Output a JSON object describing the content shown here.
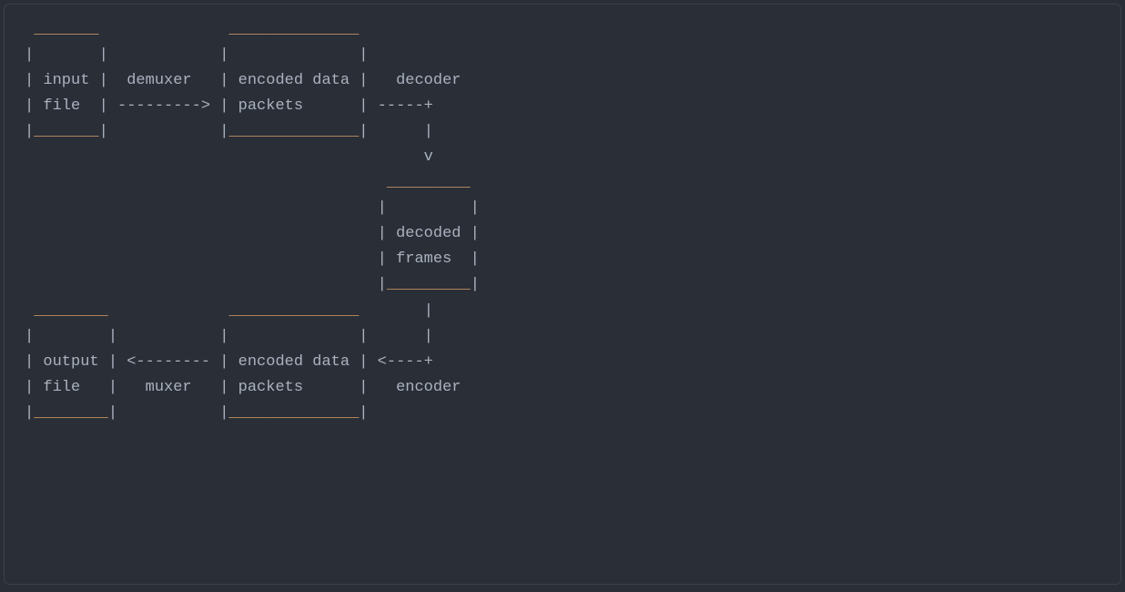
{
  "diagram": {
    "lines": [
      {
        "segments": [
          {
            "t": " "
          },
          {
            "t": "_______",
            "c": "accent"
          },
          {
            "t": "              "
          },
          {
            "t": "______________",
            "c": "accent"
          }
        ]
      },
      {
        "segments": [
          {
            "t": "|       |            |              |"
          }
        ]
      },
      {
        "segments": [
          {
            "t": "| input |  demuxer   | encoded data |   decoder"
          }
        ]
      },
      {
        "segments": [
          {
            "t": "| file  | ---------> | packets      | -----+"
          }
        ]
      },
      {
        "segments": [
          {
            "t": "|"
          },
          {
            "t": "_______",
            "c": "accent"
          },
          {
            "t": "|            |"
          },
          {
            "t": "______________",
            "c": "accent"
          },
          {
            "t": "|      |"
          }
        ]
      },
      {
        "segments": [
          {
            "t": "                                           v"
          }
        ]
      },
      {
        "segments": [
          {
            "t": "                                       "
          },
          {
            "t": "_________",
            "c": "accent"
          }
        ]
      },
      {
        "segments": [
          {
            "t": "                                      |         |"
          }
        ]
      },
      {
        "segments": [
          {
            "t": "                                      | decoded |"
          }
        ]
      },
      {
        "segments": [
          {
            "t": "                                      | frames  |"
          }
        ]
      },
      {
        "segments": [
          {
            "t": "                                      |"
          },
          {
            "t": "_________",
            "c": "accent"
          },
          {
            "t": "|"
          }
        ]
      },
      {
        "segments": [
          {
            "t": " "
          },
          {
            "t": "________",
            "c": "accent"
          },
          {
            "t": "             "
          },
          {
            "t": "______________",
            "c": "accent"
          },
          {
            "t": "       |"
          }
        ]
      },
      {
        "segments": [
          {
            "t": "|        |           |              |      |"
          }
        ]
      },
      {
        "segments": [
          {
            "t": "| output | <-------- | encoded data | <----+"
          }
        ]
      },
      {
        "segments": [
          {
            "t": "| file   |   muxer   | packets      |   encoder"
          }
        ]
      },
      {
        "segments": [
          {
            "t": "|"
          },
          {
            "t": "________",
            "c": "accent"
          },
          {
            "t": "|           |"
          },
          {
            "t": "______________",
            "c": "accent"
          },
          {
            "t": "|"
          }
        ]
      }
    ]
  }
}
